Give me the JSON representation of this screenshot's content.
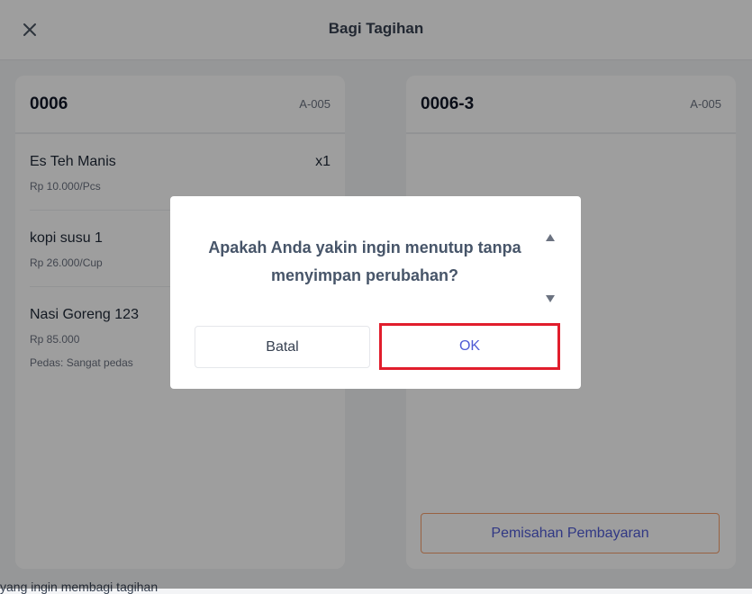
{
  "header": {
    "title": "Bagi Tagihan",
    "close_icon": "close-icon"
  },
  "left_panel": {
    "order_id": "0006",
    "table_code": "A-005",
    "items": [
      {
        "name": "Es Teh Manis",
        "price": "Rp 10.000/Pcs",
        "qty": "x1",
        "note": ""
      },
      {
        "name": "kopi susu 1",
        "price": "Rp 26.000/Cup",
        "qty": "",
        "note": ""
      },
      {
        "name": "Nasi Goreng 123",
        "price": "Rp 85.000",
        "qty": "",
        "note": "Pedas: Sangat pedas"
      }
    ]
  },
  "right_panel": {
    "order_id": "0006-3",
    "table_code": "A-005",
    "split_payment_label": "Pemisahan Pembayaran"
  },
  "footer": {
    "text": "yang ingin membagi tagihan"
  },
  "dialog": {
    "message": "Apakah Anda yakin ingin menutup tanpa menyimpan perubahan?",
    "cancel_label": "Batal",
    "ok_label": "OK"
  },
  "colors": {
    "accent": "#4f5bd5",
    "highlight": "#e11d2c",
    "split_border": "#f59e6b"
  }
}
